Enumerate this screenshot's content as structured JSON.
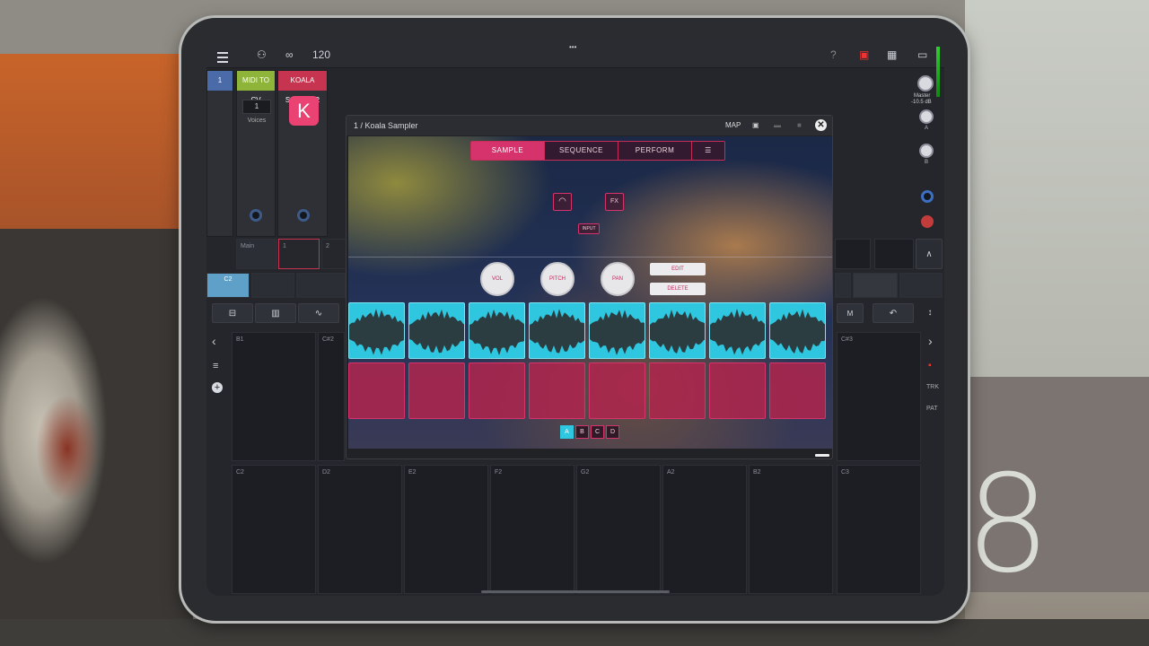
{
  "topbar": {
    "tempo": "120",
    "help": "?",
    "dots": "•••"
  },
  "mixer": {
    "master_label": "Master",
    "master_db": "-10.5 dB",
    "send_a": "A",
    "send_b": "B"
  },
  "tracks": {
    "track_number": "1",
    "midi_to_cv": {
      "label": "MIDI TO CV",
      "color": "#8fb43a",
      "voices_value": "1",
      "voices_label": "Voices"
    },
    "koala": {
      "label": "KOALA SAMPLER",
      "color": "#c7344f",
      "logo": "K"
    }
  },
  "clips": {
    "main": "Main",
    "slot1": "1",
    "slot2": "2",
    "c2": "C2"
  },
  "sampler": {
    "title": "1 / Koala Sampler",
    "map": "MAP",
    "tabs": [
      "SAMPLE",
      "SEQUENCE",
      "PERFORM"
    ],
    "fx": "FX",
    "input": "INPUT",
    "knobs": [
      "VOL",
      "PITCH",
      "PAN"
    ],
    "edit": "EDIT",
    "delete": "DELETE",
    "banks": [
      "A",
      "B",
      "C",
      "D"
    ],
    "accent": "#d6336c",
    "wave_color": "#2fc6e0"
  },
  "keys": {
    "upper": [
      "B1",
      "C#2",
      "C#3"
    ],
    "lower": [
      "C2",
      "D2",
      "E2",
      "F2",
      "G2",
      "A2",
      "B2",
      "C3"
    ]
  },
  "side": {
    "trk": "TRK",
    "pat": "PAT",
    "m": "M"
  }
}
